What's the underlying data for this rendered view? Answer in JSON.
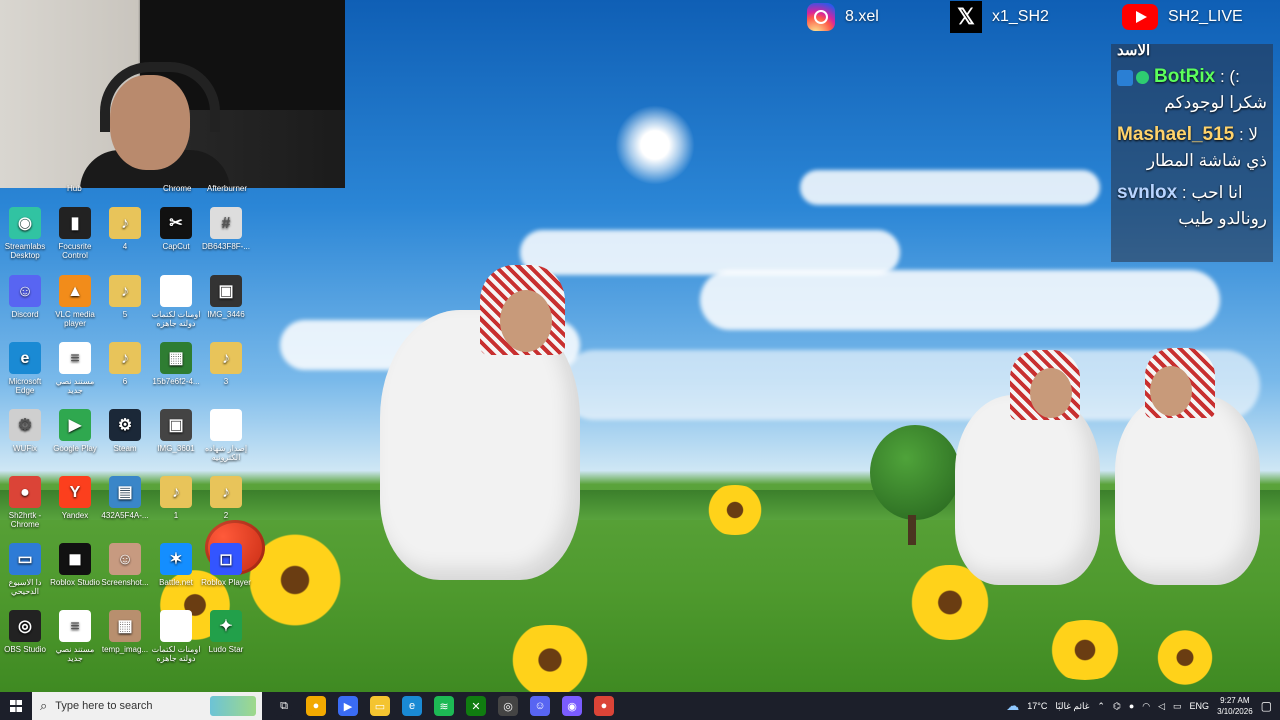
{
  "socials": {
    "instagram": "8.xel",
    "x": "x1_SH2",
    "youtube": "SH2_LIVE"
  },
  "chat": {
    "top_fragment": "الاسد",
    "messages": [
      {
        "user": "BotRix",
        "sep": " : ",
        "inline": "(:",
        "msg": "شكرا لوجودكم",
        "color": "#5cff5c"
      },
      {
        "user": "Mashael_515",
        "sep": " : ",
        "inline": "لا",
        "msg": "ذي شاشة المطار",
        "color": "#ffd36b"
      },
      {
        "user": "svnlox",
        "sep": " : ",
        "inline": "انا احب",
        "msg": "رونالدو طيب",
        "color": "#b8d4ff"
      }
    ]
  },
  "desktop": {
    "top_labels": [
      "Hub",
      "Chrome",
      "Afterburner"
    ],
    "icons": [
      {
        "label": "Streamlabs Desktop",
        "glyph": "◉",
        "color": "#31c3a2",
        "icon": "streamlabs-icon"
      },
      {
        "label": "Focusrite Control",
        "glyph": "▮",
        "color": "#222",
        "icon": "focusrite-icon"
      },
      {
        "label": "4",
        "glyph": "♪",
        "color": "#e8c45a",
        "icon": "music-file-icon"
      },
      {
        "label": "CapCut",
        "glyph": "✂",
        "color": "#111",
        "icon": "capcut-icon"
      },
      {
        "label": "DB643F8F-...",
        "glyph": "#",
        "color": "#ddd",
        "icon": "image-file-icon"
      },
      {
        "label": "Discord",
        "glyph": "☺",
        "color": "#5865f2",
        "icon": "discord-icon"
      },
      {
        "label": "VLC media player",
        "glyph": "▲",
        "color": "#f28c1a",
        "icon": "vlc-icon"
      },
      {
        "label": "5",
        "glyph": "♪",
        "color": "#e8c45a",
        "icon": "music-file-icon"
      },
      {
        "label": "اومنات لكتمات دولته جاهزه",
        "glyph": "",
        "color": "#fff",
        "icon": "document-icon"
      },
      {
        "label": "IMG_3446",
        "glyph": "▣",
        "color": "#333",
        "icon": "image-file-icon"
      },
      {
        "label": "Microsoft Edge",
        "glyph": "e",
        "color": "#1a8ad4",
        "icon": "edge-icon"
      },
      {
        "label": "مستند نصي جديد",
        "glyph": "≡",
        "color": "#fff",
        "icon": "text-document-icon"
      },
      {
        "label": "6",
        "glyph": "♪",
        "color": "#e8c45a",
        "icon": "music-file-icon"
      },
      {
        "label": "15b7e6f2-4...",
        "glyph": "▦",
        "color": "#2e7d32",
        "icon": "image-file-icon"
      },
      {
        "label": "3",
        "glyph": "♪",
        "color": "#e8c45a",
        "icon": "music-file-icon"
      },
      {
        "label": "WUFix",
        "glyph": "⚙",
        "color": "#cfcfcf",
        "icon": "wufix-icon"
      },
      {
        "label": "Google Play",
        "glyph": "▶",
        "color": "#2fa84f",
        "icon": "google-play-icon"
      },
      {
        "label": "Steam",
        "glyph": "⚙",
        "color": "#1b2838",
        "icon": "steam-icon"
      },
      {
        "label": "IMG_3601",
        "glyph": "▣",
        "color": "#444",
        "icon": "image-file-icon"
      },
      {
        "label": "إصدار شهاده الكترونيه",
        "glyph": "",
        "color": "#fff",
        "icon": "document-icon"
      },
      {
        "label": "Sh2hrtk - Chrome",
        "glyph": "●",
        "color": "#db4437",
        "icon": "chrome-icon"
      },
      {
        "label": "Yandex",
        "glyph": "Y",
        "color": "#fc3f1d",
        "icon": "yandex-icon"
      },
      {
        "label": "432A5F4A-...",
        "glyph": "▤",
        "color": "#3a86c8",
        "icon": "image-file-icon"
      },
      {
        "label": "1",
        "glyph": "♪",
        "color": "#e8c45a",
        "icon": "music-file-icon"
      },
      {
        "label": "2",
        "glyph": "♪",
        "color": "#e8c45a",
        "icon": "music-file-icon"
      },
      {
        "label": "دا الاسبوع الدحيحي",
        "glyph": "▭",
        "color": "#2e7bd6",
        "icon": "folder-icon"
      },
      {
        "label": "Roblox Studio",
        "glyph": "◼",
        "color": "#111",
        "icon": "roblox-studio-icon"
      },
      {
        "label": "Screenshot...",
        "glyph": "☺",
        "color": "#c79a80",
        "icon": "screenshot-icon"
      },
      {
        "label": "Battle.net",
        "glyph": "✶",
        "color": "#148eff",
        "icon": "battlenet-icon"
      },
      {
        "label": "Roblox Player",
        "glyph": "◻",
        "color": "#3355ff",
        "icon": "roblox-player-icon"
      },
      {
        "label": "OBS Studio",
        "glyph": "◎",
        "color": "#222",
        "icon": "obs-icon"
      },
      {
        "label": "مستند نصي جديد",
        "glyph": "≡",
        "color": "#fff",
        "icon": "text-document-icon"
      },
      {
        "label": "temp_imag...",
        "glyph": "▦",
        "color": "#b88f6e",
        "icon": "image-file-icon"
      },
      {
        "label": "اومنات لكتمات دولته جاهزه",
        "glyph": "",
        "color": "#fff",
        "icon": "document-icon"
      },
      {
        "label": "Ludo Star",
        "glyph": "✦",
        "color": "#22a04a",
        "icon": "ludo-star-icon"
      }
    ]
  },
  "taskbar": {
    "search_placeholder": "Type here to search",
    "weather": "17°C",
    "weather_text": "غائم غالبًا",
    "language": "ENG",
    "time": "9:27 AM",
    "date": "3/10/2026",
    "apps": [
      {
        "icon": "task-view-icon",
        "glyph": "⧉",
        "color": "#1c1f2a"
      },
      {
        "icon": "chrome-canary-icon",
        "glyph": "●",
        "color": "#f2a900"
      },
      {
        "icon": "google-play-games-icon",
        "glyph": "▶",
        "color": "#3a6cf4"
      },
      {
        "icon": "file-explorer-icon",
        "glyph": "▭",
        "color": "#f4c430"
      },
      {
        "icon": "edge-icon",
        "glyph": "e",
        "color": "#1a8ad4"
      },
      {
        "icon": "spotify-icon",
        "glyph": "≋",
        "color": "#1db954"
      },
      {
        "icon": "xbox-icon",
        "glyph": "✕",
        "color": "#107c10"
      },
      {
        "icon": "obs-icon",
        "glyph": "◎",
        "color": "#444"
      },
      {
        "icon": "discord-icon",
        "glyph": "☺",
        "color": "#5865f2"
      },
      {
        "icon": "streamlabs-icon",
        "glyph": "◉",
        "color": "#7a5cff"
      },
      {
        "icon": "chrome-icon",
        "glyph": "●",
        "color": "#db4437"
      }
    ]
  }
}
